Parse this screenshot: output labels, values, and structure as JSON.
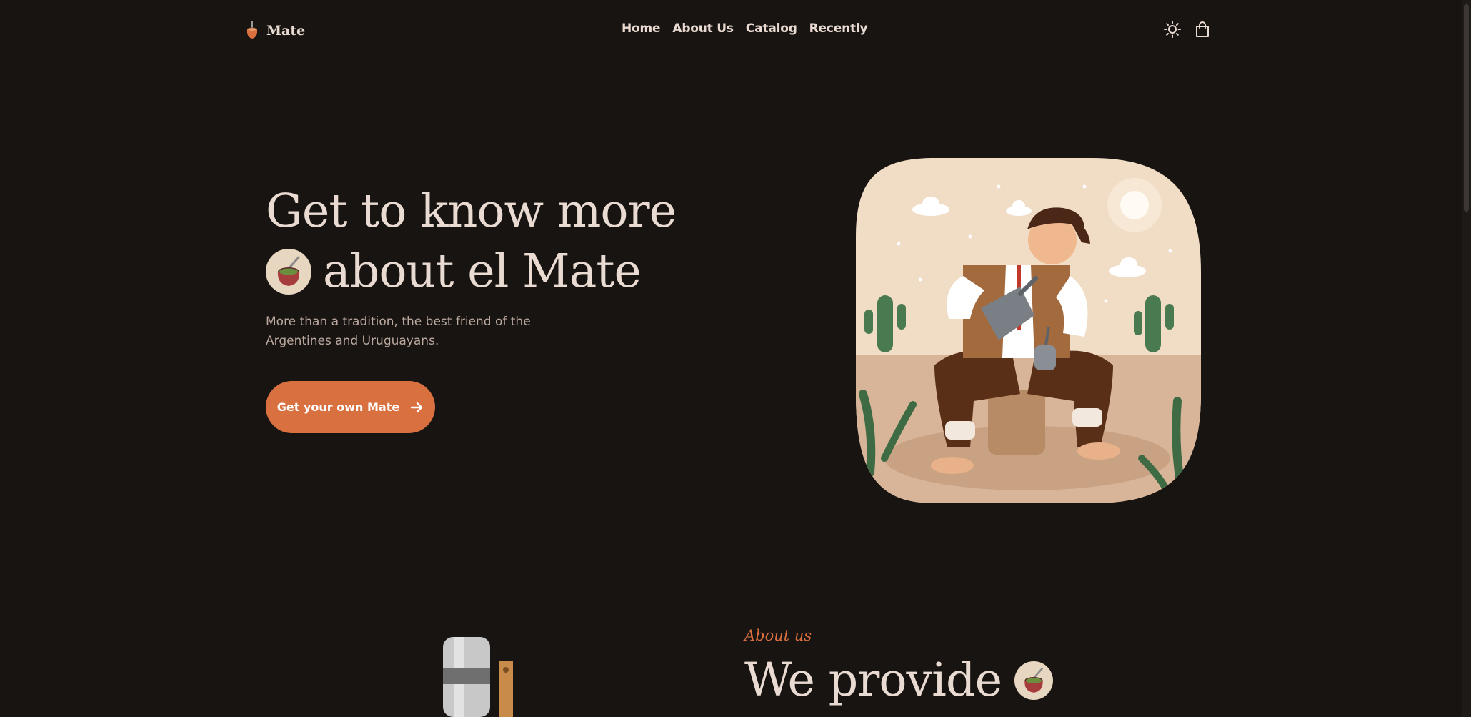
{
  "brand": {
    "name": "Mate"
  },
  "nav": {
    "items": [
      "Home",
      "About Us",
      "Catalog",
      "Recently"
    ]
  },
  "header_actions": {
    "theme_toggle_icon": "sun-icon",
    "cart_icon": "shopping-bag-icon"
  },
  "hero": {
    "title_line1": "Get to know more",
    "title_line2": "about el Mate",
    "description": "More than a tradition, the best friend of the Argentines and Uruguayans.",
    "cta_label": "Get your own Mate",
    "cta_icon": "arrow-right-icon"
  },
  "about": {
    "kicker": "About us",
    "heading": "We provide"
  },
  "colors": {
    "background": "#181412",
    "text": "#eadbd2",
    "muted_text": "#bba89e",
    "accent": "#d97040"
  }
}
